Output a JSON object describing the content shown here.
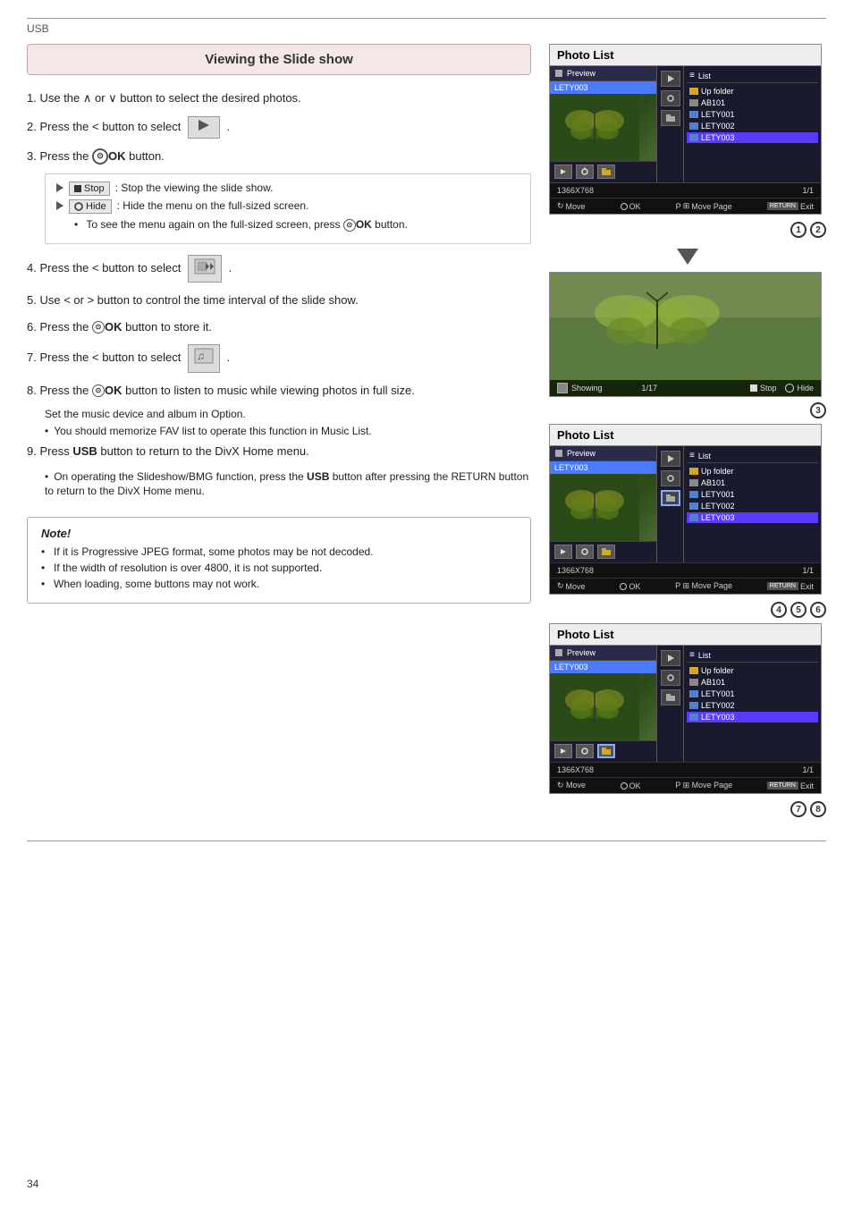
{
  "page": {
    "label": "USB",
    "page_number": "34"
  },
  "title": "Viewing the Slide show",
  "instructions": [
    {
      "num": "1.",
      "text": "Use the ∧ or ∨ button to select the desired photos."
    },
    {
      "num": "2.",
      "text": "Press the < button to select"
    },
    {
      "num": "3.",
      "text": "Press the ⊙OK button."
    },
    {
      "num": "4.",
      "text": "Press the < button to select"
    },
    {
      "num": "5.",
      "text": "Use < or > button to control the time interval of the slide show."
    },
    {
      "num": "6.",
      "text": "Press the ⊙OK button to store it."
    },
    {
      "num": "7.",
      "text": "Press the < button to select"
    },
    {
      "num": "8.",
      "text": "Press the ⊙OK button to listen to music while viewing photos in full size.",
      "sub1": "Set the music device and album in Option.",
      "sub2": "You should memorize FAV list to operate this function in Music List."
    },
    {
      "num": "9.",
      "text": "Press USB button to return to the DivX Home menu.",
      "sub1": "On operating the Slideshow/BMG function, press the USB button after pressing the RETURN button to return to the DivX Home menu."
    }
  ],
  "infobox": {
    "stop_label": "Stop",
    "stop_desc": ": Stop the viewing the slide show.",
    "hide_label": "Hide",
    "hide_desc": ": Hide the menu on the full-sized screen.",
    "note1": "To see the menu again on the full-sized screen, press",
    "note1_btn": "⊙OK",
    "note1_end": "button."
  },
  "photo_list_1": {
    "title": "Photo List",
    "preview_label": "Preview",
    "list_label": "List",
    "selected_name": "LETY003",
    "up_folder": "Up folder",
    "items": [
      "AB101",
      "LETY001",
      "LETY002",
      "LETY003"
    ],
    "resolution": "1366X768",
    "page": "1/1",
    "controls": [
      "Move",
      "OK",
      "Move Page",
      "Exit"
    ]
  },
  "slideshow_display": {
    "showing_label": "Showing",
    "page": "1/17",
    "stop_label": "Stop",
    "hide_label": "Hide"
  },
  "note_section": {
    "title": "Note!",
    "items": [
      "If it is Progressive JPEG format, some photos may be not decoded.",
      "If the width of resolution is over 4800, it is not supported.",
      "When loading, some buttons may not work."
    ]
  },
  "circle_numbers_1": [
    "1",
    "2"
  ],
  "circle_numbers_2": [
    "3"
  ],
  "circle_numbers_3": [
    "4",
    "5",
    "6"
  ],
  "circle_numbers_4": [
    "7",
    "8"
  ]
}
